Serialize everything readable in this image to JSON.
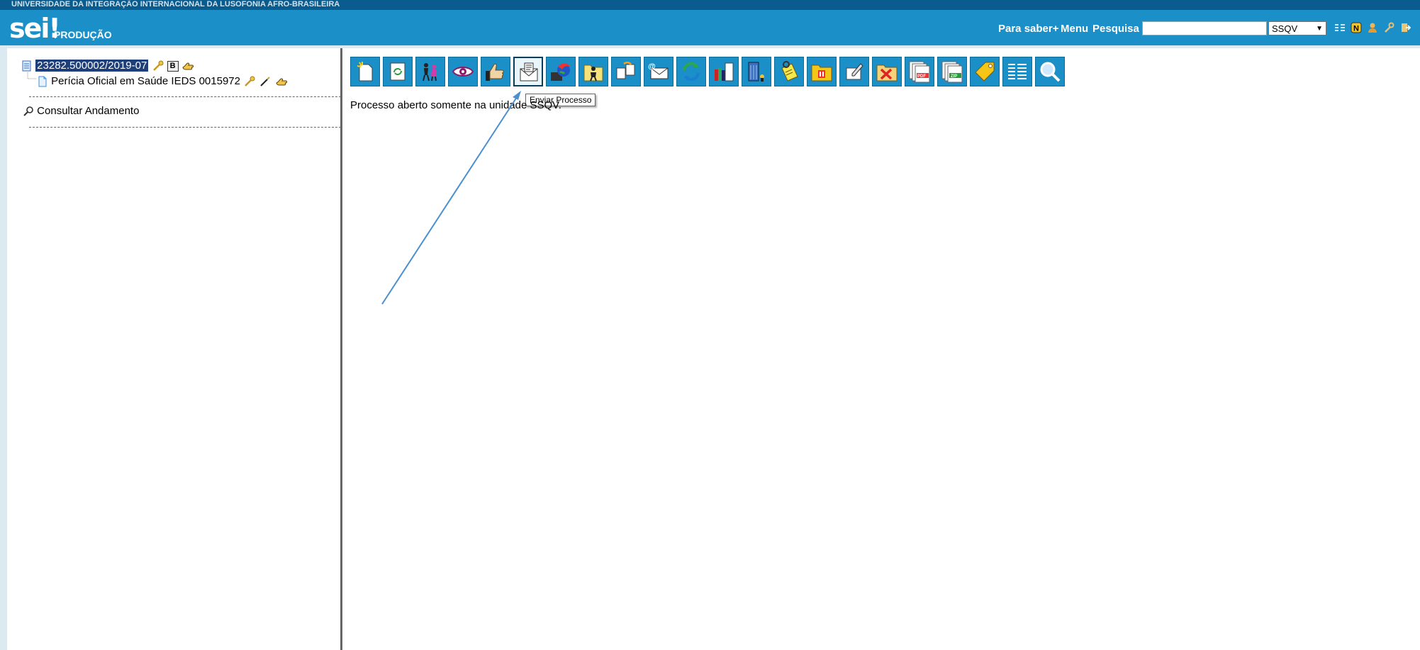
{
  "header": {
    "institution": "UNIVERSIDADE DA INTEGRAÇÃO INTERNACIONAL DA LUSOFONIA AFRO-BRASILEIRA",
    "logo": "sei!",
    "environment": "PRODUÇÃO",
    "nav": {
      "para_saber": "Para saber+",
      "menu": "Menu",
      "pesquisa": "Pesquisa"
    },
    "search_value": "",
    "unit_selected": "SSQV",
    "icons": [
      "list-icon",
      "news-icon",
      "user-icon",
      "tools-icon",
      "exit-icon"
    ]
  },
  "tree": {
    "process_number": "23282.500002/2019-07",
    "process_badge": "B",
    "document": "Perícia Oficial em Saúde IEDS 0015972",
    "consultar": "Consultar Andamento"
  },
  "toolbar": {
    "buttons": [
      {
        "name": "incluir-documento",
        "icon": "new-document-icon"
      },
      {
        "name": "iniciar-processo-relacionado",
        "icon": "related-process-icon"
      },
      {
        "name": "acesso-externo",
        "icon": "people-icon"
      },
      {
        "name": "acompanhamento-especial",
        "icon": "eye-icon"
      },
      {
        "name": "ciencia",
        "icon": "thumbs-up-icon"
      },
      {
        "name": "enviar-processo",
        "icon": "send-process-icon",
        "active": true
      },
      {
        "name": "atualizar-andamento",
        "icon": "globe-icon"
      },
      {
        "name": "atribuir-processo",
        "icon": "person-folder-icon"
      },
      {
        "name": "duplicar-processo",
        "icon": "duplicate-icon"
      },
      {
        "name": "enviar-email",
        "icon": "email-icon"
      },
      {
        "name": "relacionamentos",
        "icon": "refresh-icon"
      },
      {
        "name": "gerenciar-marcador",
        "icon": "books-icon"
      },
      {
        "name": "blocos",
        "icon": "building-icon"
      },
      {
        "name": "anotacoes",
        "icon": "notes-icon"
      },
      {
        "name": "sobrestar-processo",
        "icon": "pause-icon"
      },
      {
        "name": "concluir-processo",
        "icon": "edit-doc-icon"
      },
      {
        "name": "excluir-processo",
        "icon": "delete-folder-icon"
      },
      {
        "name": "gerar-pdf",
        "icon": "pdf-icon"
      },
      {
        "name": "gerar-zip",
        "icon": "zip-icon"
      },
      {
        "name": "marcador",
        "icon": "tag-icon"
      },
      {
        "name": "listar-documentos",
        "icon": "list-icon"
      },
      {
        "name": "pesquisar-processo",
        "icon": "magnifier-icon"
      }
    ],
    "tooltip": "Enviar Processo"
  },
  "main": {
    "message": "Processo aberto somente na unidade SSQV."
  },
  "colors": {
    "header_bg": "#1b8fc7",
    "top_strip": "#0a5c8e",
    "arrow": "#4a90d0"
  }
}
